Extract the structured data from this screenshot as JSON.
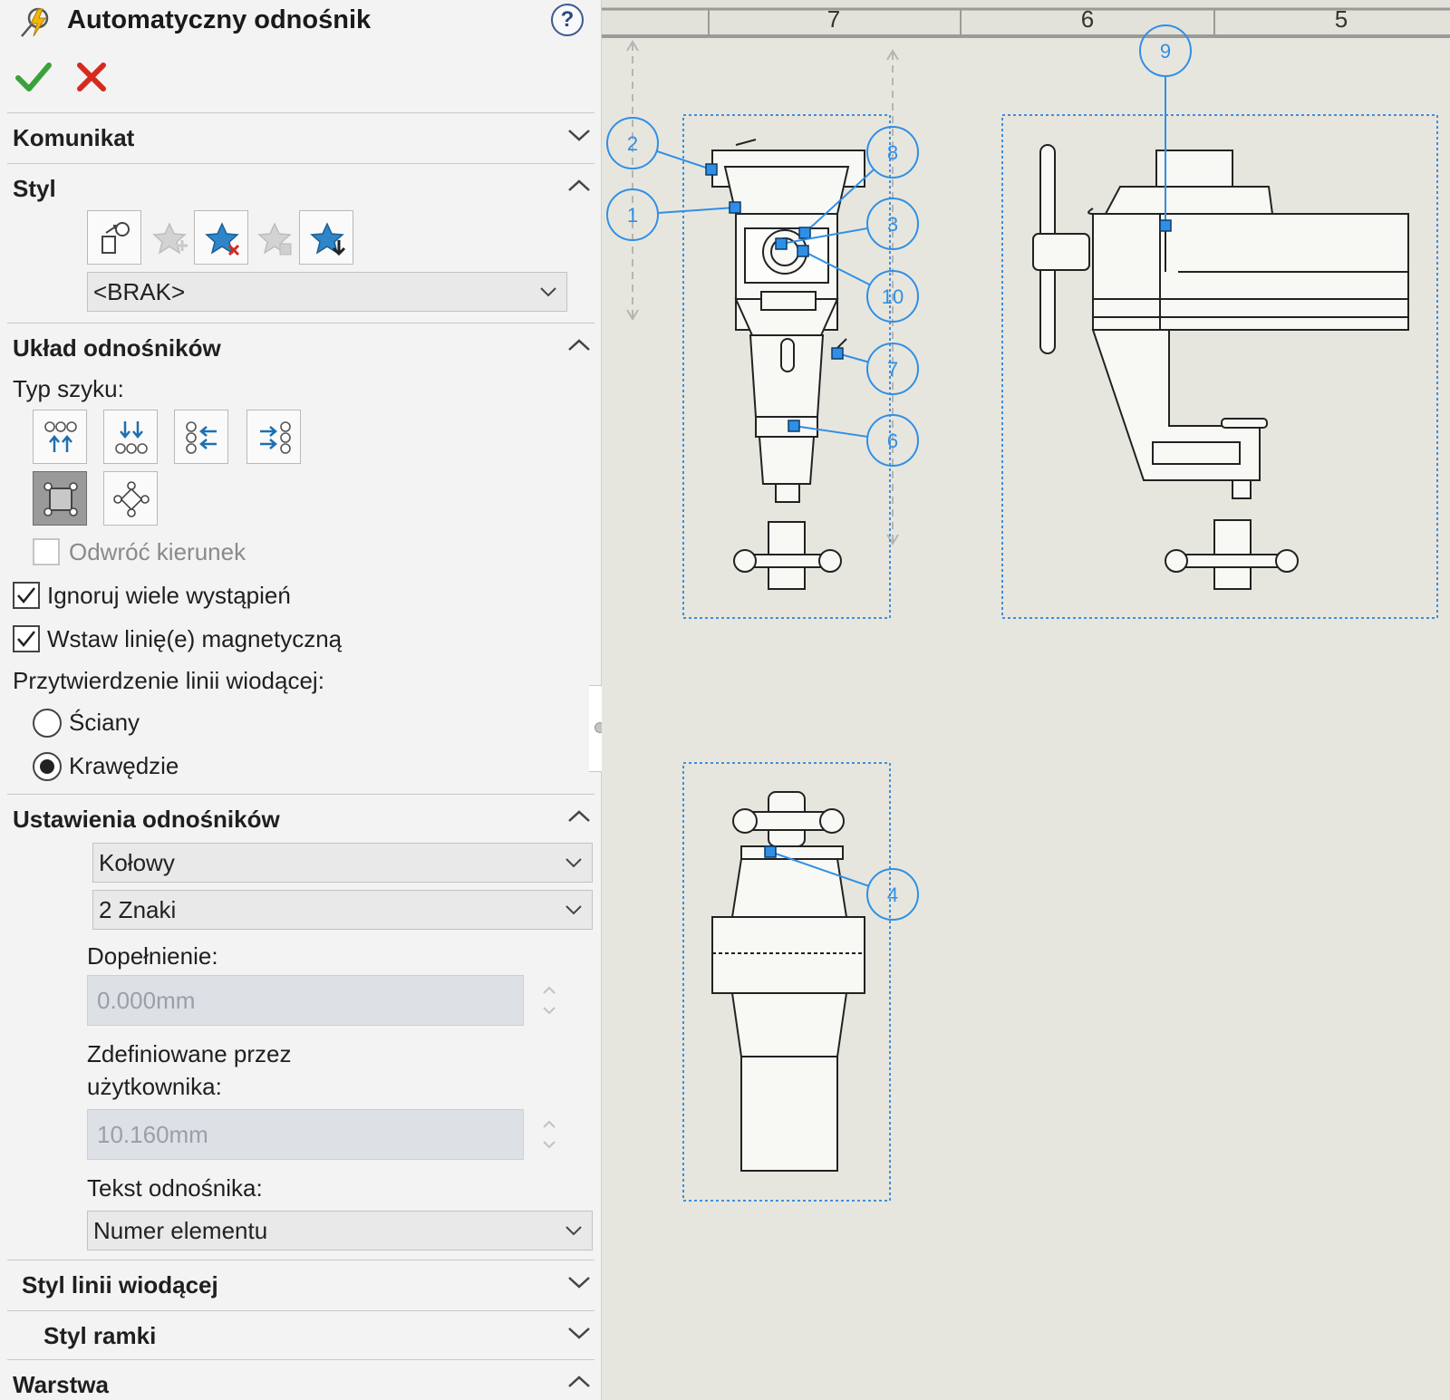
{
  "header": {
    "title": "Automatyczny odnośnik",
    "help_glyph": "?"
  },
  "actions": {
    "ok_icon": "checkmark-icon",
    "cancel_icon": "x-icon"
  },
  "sections": {
    "message": "Komunikat",
    "style": "Styl",
    "layout": "Układ odnośników",
    "balloon_settings": "Ustawienia odnośników",
    "leader_style": "Styl linii wiodącej",
    "frame_style": "Styl ramki",
    "layer": "Warstwa"
  },
  "style": {
    "icons": [
      "apply-style-icon",
      "add-style-icon",
      "delete-style-icon",
      "save-style-icon",
      "load-style-icon"
    ],
    "selected": "<BRAK>"
  },
  "layout": {
    "pattern_label": "Typ szyku:",
    "pattern_icons": [
      "layout-top-icon",
      "layout-bottom-icon",
      "layout-left-icon",
      "layout-right-icon",
      "layout-square-icon",
      "layout-circular-icon"
    ],
    "reverse_label": "Odwróć kierunek",
    "reverse_checked": false,
    "reverse_enabled": false,
    "ignore_label": "Ignoruj wiele wystąpień",
    "ignore_checked": true,
    "magnetic_label": "Wstaw linię(e) magnetyczną",
    "magnetic_checked": true,
    "attach_label": "Przytwierdzenie linii wiodącej:",
    "attach_options": [
      "Ściany",
      "Krawędzie"
    ],
    "attach_selected": "Krawędzie"
  },
  "balloon_settings": {
    "style_value": "Kołowy",
    "size_value": "2 Znaki",
    "padding_label": "Dopełnienie:",
    "padding_value": "0.000mm",
    "user_defined_label_1": "Zdefiniowane przez",
    "user_defined_label_2": "użytkownika:",
    "user_defined_value": "10.160mm",
    "text_label": "Tekst odnośnika:",
    "text_value": "Numer elementu"
  },
  "drawing": {
    "zone_labels": [
      "7",
      "6",
      "5"
    ],
    "balloons": [
      "2",
      "1",
      "8",
      "3",
      "10",
      "7",
      "6",
      "9",
      "4"
    ],
    "background": "#e7e6de",
    "balloon_color": "#2f8fe6"
  }
}
